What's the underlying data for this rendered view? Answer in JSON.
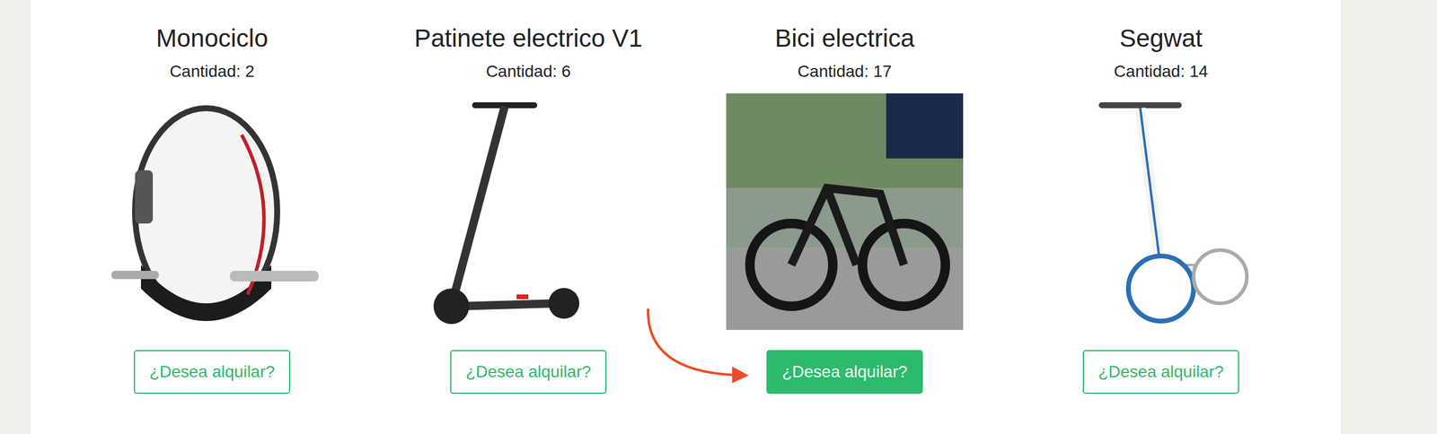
{
  "products": [
    {
      "name": "Monociclo",
      "quantity": "Cantidad: 2",
      "button": "¿Desea alquilar?",
      "selected": false
    },
    {
      "name": "Patinete electrico V1",
      "quantity": "Cantidad: 6",
      "button": "¿Desea alquilar?",
      "selected": false
    },
    {
      "name": "Bici electrica",
      "quantity": "Cantidad: 17",
      "button": "¿Desea alquilar?",
      "selected": true
    },
    {
      "name": "Segwat",
      "quantity": "Cantidad: 14",
      "button": "¿Desea alquilar?",
      "selected": false
    }
  ]
}
